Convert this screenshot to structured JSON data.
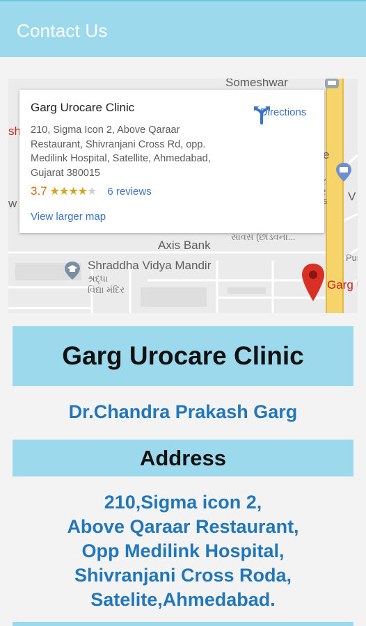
{
  "appbar": {
    "title": "Contact Us"
  },
  "map": {
    "labels": {
      "someshwar": "Someshwar",
      "axis_bank": "Axis Bank",
      "shraddha": "Shraddha Vidya Mandir",
      "shraddha_local_1": "શ્રદ્ધા",
      "shraddha_local_2": "વિદ્યા મંદિર",
      "gujarati_road": "સાવસ (છાંડવના...",
      "garg_pin_label": "Garg U",
      "puni": "Puni",
      "edge_left_sh": "sh",
      "edge_left_w": "w",
      "edge_right_v": "V",
      "edge_right_e": "e",
      "edge_gu_1": "ટ",
      "edge_gu_2": "ર",
      "edge_gu_3": "s"
    },
    "card": {
      "title": "Garg Urocare Clinic",
      "address": "210, Sigma Icon 2, Above Qaraar Restaurant, Shivranjani Cross Rd, opp. Medilink Hospital, Satellite, Ahmedabad, Gujarat 380015",
      "rating": "3.7",
      "stars_filled": "★★★★",
      "stars_empty": "★",
      "reviews": "6 reviews",
      "view_larger": "View larger map",
      "directions": "Directions"
    },
    "colors": {
      "pin": "#d93025",
      "road_yellow": "#f6d46a",
      "link": "#3b74c4"
    }
  },
  "clinic": {
    "name": "Garg Urocare Clinic",
    "doctor": "Dr.Chandra Prakash Garg"
  },
  "address": {
    "heading": "Address",
    "lines": [
      "210,Sigma icon 2,",
      "Above Qaraar Restaurant,",
      "Opp Medilink Hospital,",
      "Shivranjani Cross Roda,",
      "Satelite,Ahmedabad."
    ]
  },
  "theme": {
    "band": "#9dd9ec",
    "accent_text": "#2277bb"
  }
}
